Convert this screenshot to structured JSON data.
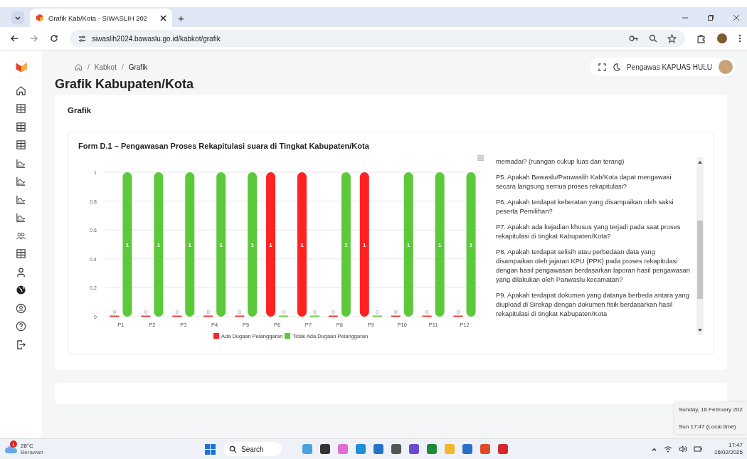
{
  "browser": {
    "tab_title": "Grafik Kab/Kota - SIWASLIH 202",
    "new_tab": "+",
    "url": "siwaslih2024.bawaslu.go.id/kabkot/grafik"
  },
  "sidebar": {
    "items": [
      {
        "kind": "home"
      },
      {
        "kind": "table"
      },
      {
        "kind": "table"
      },
      {
        "kind": "table"
      },
      {
        "kind": "chart"
      },
      {
        "kind": "chart"
      },
      {
        "kind": "chart"
      },
      {
        "kind": "chart"
      },
      {
        "kind": "users"
      },
      {
        "kind": "table"
      },
      {
        "kind": "user"
      },
      {
        "kind": "globe"
      },
      {
        "kind": "account"
      },
      {
        "kind": "help"
      },
      {
        "kind": "logout"
      }
    ]
  },
  "breadcrumb": {
    "separator": "/",
    "items": [
      "Kabkot",
      "Grafik"
    ]
  },
  "user": {
    "name": "Pengawas KAPUAS HULU"
  },
  "page_title": "Grafik Kabupaten/Kota",
  "card": {
    "title": "Grafik",
    "chart": {
      "title": "Form D.1 – Pengawasan Proses Rekapitulasi suara di Tingkat Kabupaten/Kota",
      "chart_data": {
        "type": "bar",
        "categories": [
          "P1",
          "P2",
          "P3",
          "P4",
          "P5",
          "P6",
          "P7",
          "P8",
          "P9",
          "P10",
          "P11",
          "P12"
        ],
        "series": [
          {
            "name": "Ada Dugaan Pelanggaran",
            "color": "#ff2222",
            "values": [
              0,
              0,
              0,
              0,
              0,
              1,
              1,
              0,
              1,
              0,
              0,
              0
            ]
          },
          {
            "name": "Tidak Ada Dugaan Pelanggaran",
            "color": "#5cc93a",
            "values": [
              1,
              1,
              1,
              1,
              1,
              0,
              0,
              1,
              0,
              1,
              1,
              1
            ]
          }
        ],
        "ylim": [
          0,
          1
        ],
        "yticks": [
          0,
          0.2,
          0.4,
          0.6,
          0.8,
          1
        ],
        "data_labels": true,
        "grid": true,
        "legend": true
      }
    },
    "questions": [
      "memadai? (ruangan cukup luas dan terang)",
      "P5. Apakah Bawaslu/Panwaslih Kab/Kota dapat mengawasi secara langsung semua proses rekapitulasi?",
      "P6. Apakah terdapat keberatan yang disampaikan oleh saksi peserta Pemilihan?",
      "P7. Apakah ada kejadian khusus yang terjadi pada saat proses rekapitulasi di tingkat Kabupaten/Kota?",
      "P8. Apakah terdapat selisih atau perbedaan data yang disampaikan oleh jajaran KPU (PPK) pada proses rekapitulasi dengan hasil pengawasan berdasarkan laporan hasil pengawasan yang dilakukan oleh Panwaslu kecamatan?",
      "P9. Apakah terdapat dokumen yang datanya berbeda antara yang diupload di Sirekap dengan dokumen fisik berdasarkan hasil rekapitulasi di tingkat Kabupaten/Kota"
    ]
  },
  "clock_flyout": {
    "date": "Sunday, 16 February 202",
    "time": "Sun 17:47 (Local time)"
  },
  "taskbar": {
    "temperature": "28°C",
    "weather": "Berawan",
    "badge": "1",
    "search": "Search",
    "time": "17:47",
    "date": "16/02/2025"
  }
}
